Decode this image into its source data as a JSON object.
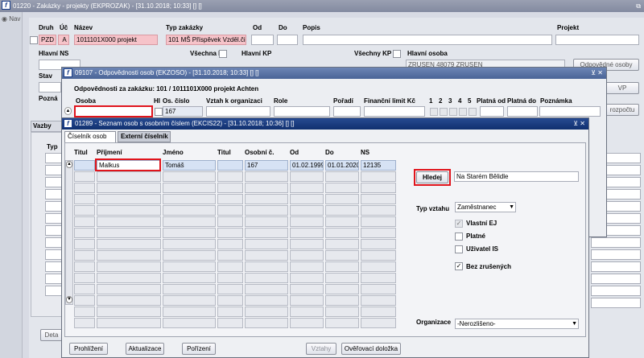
{
  "main_window": {
    "title": "01220 - Zakázky - projekty (EKPROZAK) - [31.10.2018; 10:33] [] []",
    "restore_icon": "restore-icon",
    "nav_label": "Nav",
    "labels": {
      "druh": "Druh",
      "uc": "Úč",
      "nazev": "Název",
      "typ_zakazky": "Typ zakázky",
      "od": "Od",
      "do": "Do",
      "popis": "Popis",
      "projekt": "Projekt",
      "hlavni_ns": "Hlavní NS",
      "vsechna_ns": "Všechna NS",
      "hlavni_kp": "Hlavní KP",
      "vsechny_kp": "Všechny KP",
      "hlavni_osoba": "Hlavní osoba",
      "stav": "Stav",
      "pozn": "Pozná",
      "vazby": "Vazby",
      "typ": "Typ",
      "deta": "Deta"
    },
    "values": {
      "druh": "PZD",
      "uc": "A",
      "nazev": "1011101X000 projekt",
      "typ_zakazky": "101 MŠ Příspěvek Vzděl.činn",
      "hlavni_osoba": "ZRUSEN 48079 ZRUSEN"
    },
    "buttons": {
      "odpovedne_osoby": "Odpovědné osoby",
      "vp": "VP",
      "rozpoctu": "rozpočtu"
    }
  },
  "odpovednosti_window": {
    "title": "09107 - Odpovědnosti osob (EKZOSO) - [31.10.2018; 10:33] [] []",
    "subtitle": "Odpovědnosti za zakázku: 101 / 1011101X000 projekt Achten",
    "columns": [
      "Osoba",
      "Hl",
      "Os. číslo",
      "Vztah k organizaci",
      "Role",
      "Pořadí",
      "Finanční limit Kč",
      "1",
      "2",
      "3",
      "4",
      "5",
      "Platná od",
      "Platná do",
      "Poznámka"
    ],
    "row_os_cislo": "167"
  },
  "seznam_window": {
    "title": "01289 - Seznam osob s osobním číslem (EKCIS22) - [31.10.2018; 10:36] [] []",
    "tabs": [
      "Číselník osob",
      "Externí číselník"
    ],
    "columns": [
      "Titul",
      "Příjmení",
      "Jméno",
      "Titul",
      "Osobní č.",
      "Od",
      "Do",
      "NS"
    ],
    "row": {
      "prijmeni": "Malkus",
      "jmeno": "Tomáš",
      "osobni_c": "167",
      "od": "01.02.1999",
      "do": "01.01.2020",
      "ns": "12135"
    },
    "hledej_label": "Hledej",
    "search_value": "Na Starém Bělidle",
    "typ_vztahu_label": "Typ vztahu",
    "typ_vztahu_value": "Zaměstnanec",
    "checkboxes": [
      {
        "label": "Vlastní EJ",
        "checked": true,
        "disabled": true
      },
      {
        "label": "Platné",
        "checked": false,
        "disabled": false
      },
      {
        "label": "Uživatel IS",
        "checked": false,
        "disabled": false
      },
      {
        "label": "Bez zrušených",
        "checked": true,
        "disabled": false
      }
    ],
    "organizace_label": "Organizace",
    "organizace_value": "-Nerozlišeno-",
    "buttons": {
      "prohlizeni": "Prohlížení",
      "aktualizace": "Aktualizace",
      "porizeni": "Pořízení",
      "vztahy": "Vztahy",
      "overovaci": "Ověřovací doložka"
    }
  }
}
